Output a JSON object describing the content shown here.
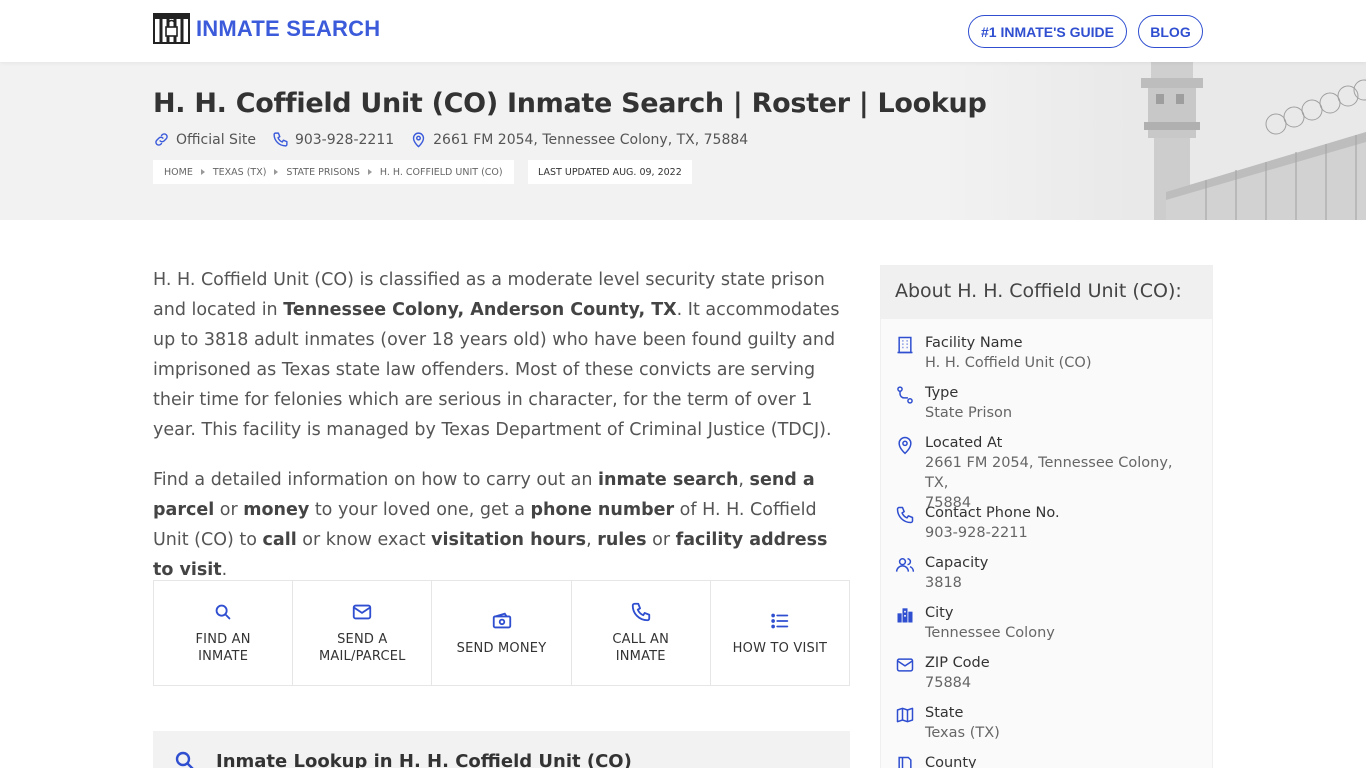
{
  "header": {
    "logo_text": "INMATE SEARCH",
    "nav_guide": "#1 INMATE'S GUIDE",
    "nav_blog": "BLOG"
  },
  "hero": {
    "title": "H. H. Coffield Unit (CO) Inmate Search | Roster | Lookup",
    "official_site": "Official Site",
    "phone": "903-928-2211",
    "address": "2661 FM 2054, Tennessee Colony, TX, 75884",
    "breadcrumbs": [
      "HOME",
      "TEXAS (TX)",
      "STATE PRISONS",
      "H. H. COFFIELD UNIT (CO)"
    ],
    "last_updated": "LAST UPDATED AUG. 09, 2022"
  },
  "intro": {
    "p1_a": "H. H. Coffield Unit (CO) is classified as a moderate level security state prison and located in ",
    "p1_b": "Tennessee Colony, Anderson County, TX",
    "p1_c": ". It accommodates up to 3818 adult inmates (over 18 years old) who have been found guilty and imprisoned as Texas state law offenders. Most of these convicts are serving their time for felonies which are serious in character, for the term of over 1 year. This facility is managed by Texas Department of Criminal Justice (TDCJ).",
    "p2_a": "Find a detailed information on how to carry out an ",
    "p2_b": "inmate search",
    "p2_c": ", ",
    "p2_d": "send a parcel",
    "p2_e": " or ",
    "p2_f": "money",
    "p2_g": " to your loved one, get a ",
    "p2_h": "phone number",
    "p2_i": " of H. H. Coffield Unit (CO) to ",
    "p2_j": "call",
    "p2_k": " or know exact ",
    "p2_l": "visitation hours",
    "p2_m": ", ",
    "p2_n": "rules",
    "p2_o": " or ",
    "p2_p": "facility address to visit",
    "p2_q": "."
  },
  "actions": [
    {
      "line1": "FIND AN",
      "line2": "INMATE",
      "icon": "search-icon"
    },
    {
      "line1": "SEND A",
      "line2": "MAIL/PARCEL",
      "icon": "mail-icon"
    },
    {
      "line1": "SEND MONEY",
      "line2": "",
      "icon": "money-icon"
    },
    {
      "line1": "CALL AN",
      "line2": "INMATE",
      "icon": "phone-icon"
    },
    {
      "line1": "HOW TO VISIT",
      "line2": "",
      "icon": "list-icon"
    }
  ],
  "lookup": {
    "title": "Inmate Lookup in H. H. Coffield Unit (CO)"
  },
  "about": {
    "heading": "About H. H. Coffield Unit (CO):",
    "rows": [
      {
        "label": "Facility Name",
        "value": "H. H. Coffield Unit (CO)",
        "icon": "building-icon"
      },
      {
        "label": "Type",
        "value": "State Prison",
        "icon": "route-icon"
      },
      {
        "label": "Located At",
        "value": "2661 FM 2054, Tennessee Colony, TX,",
        "value2": "75884",
        "icon": "map-pin-icon"
      },
      {
        "label": "Contact Phone No.",
        "value": "903-928-2211",
        "icon": "phone-icon"
      },
      {
        "label": "Capacity",
        "value": "3818",
        "icon": "users-icon"
      },
      {
        "label": "City",
        "value": "Tennessee Colony",
        "icon": "city-icon"
      },
      {
        "label": "ZIP Code",
        "value": "75884",
        "icon": "envelope-icon"
      },
      {
        "label": "State",
        "value": "Texas (TX)",
        "icon": "map-icon"
      },
      {
        "label": "County",
        "value": "",
        "icon": "county-icon"
      }
    ]
  },
  "colors": {
    "accent": "#2f4fd0",
    "hero_bg": "#f2f2f2"
  }
}
